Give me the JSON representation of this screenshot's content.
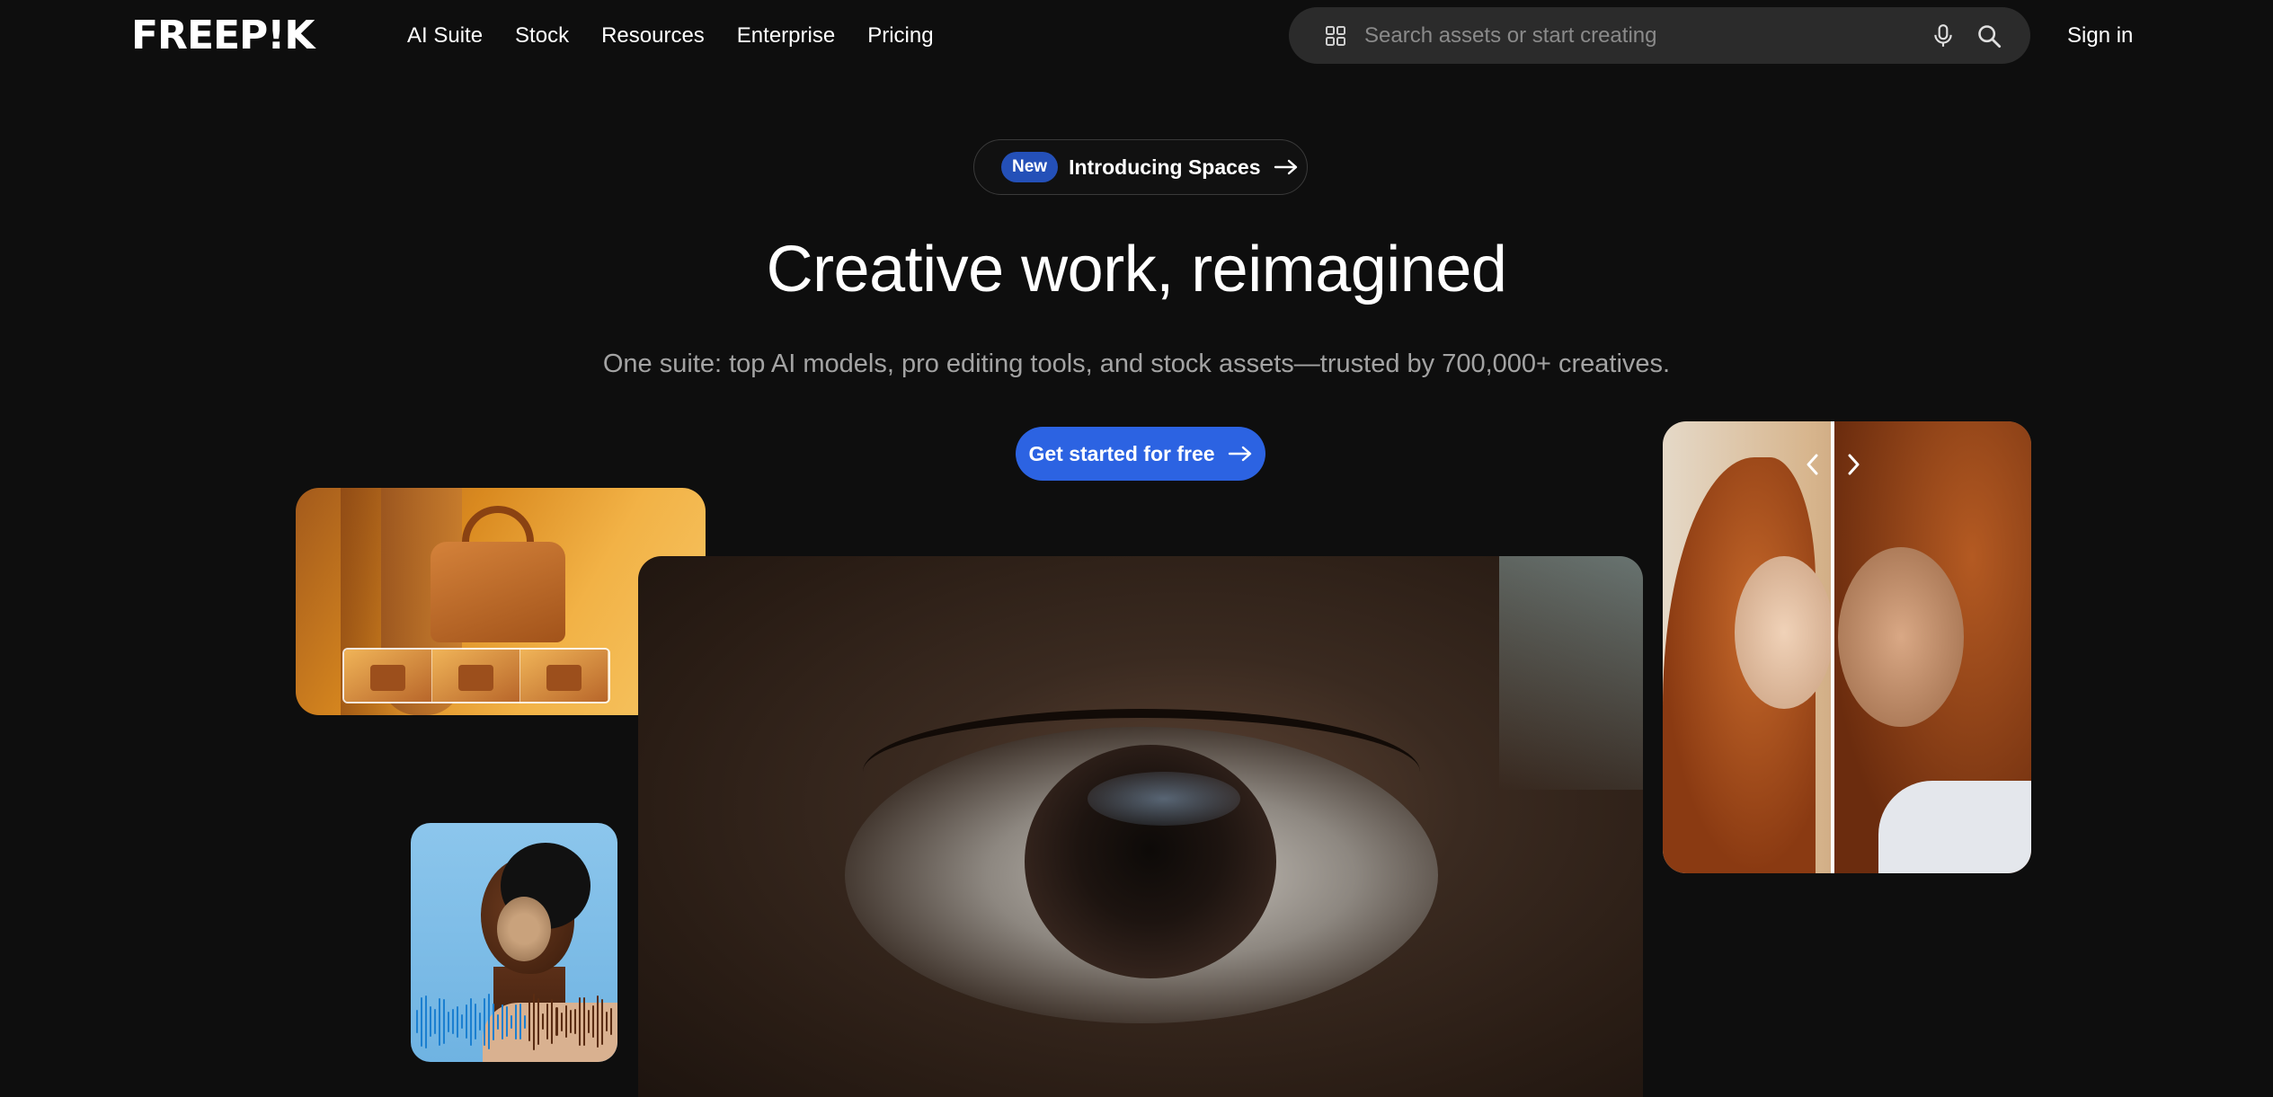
{
  "header": {
    "logo": "FREEP!K",
    "nav": [
      "AI Suite",
      "Stock",
      "Resources",
      "Enterprise",
      "Pricing"
    ],
    "search": {
      "placeholder": "Search assets or start creating"
    },
    "signin": "Sign in"
  },
  "hero": {
    "badge": "New",
    "announcement": "Introducing Spaces",
    "title": "Creative work, reimagined",
    "subtitle": "One suite: top AI models, pro editing tools, and stock assets—trusted by 700,000+ creatives.",
    "cta": "Get started for free"
  },
  "colors": {
    "background": "#0e0e0e",
    "accent": "#2c63e2",
    "badge": "#2450b8",
    "search_bg": "#2b2b2b"
  },
  "icons": [
    "grid-icon",
    "microphone-icon",
    "search-icon",
    "arrow-right-icon",
    "chevron-left-icon",
    "chevron-right-icon"
  ]
}
